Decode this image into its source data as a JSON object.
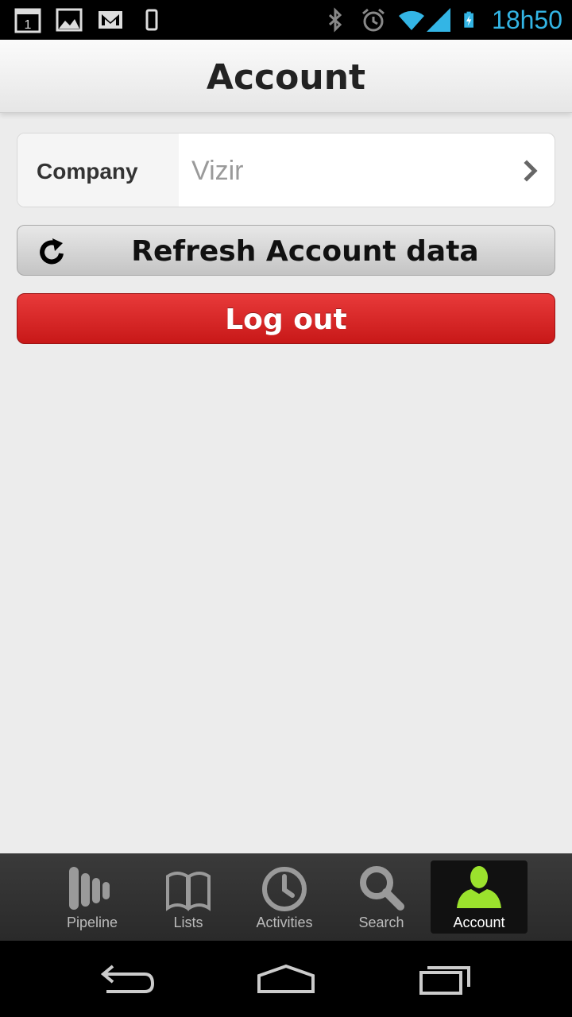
{
  "status_bar": {
    "time": "18h50",
    "left_icons": [
      "calendar-icon",
      "gallery-icon",
      "gmail-icon",
      "phone-vibrate-icon"
    ],
    "right_icons": [
      "bluetooth-icon",
      "alarm-icon",
      "wifi-icon",
      "signal-icon",
      "battery-charging-icon"
    ]
  },
  "header": {
    "title": "Account"
  },
  "company": {
    "label": "Company",
    "value": "Vizir"
  },
  "buttons": {
    "refresh_label": "Refresh Account data",
    "logout_label": "Log out"
  },
  "tabs": [
    {
      "label": "Pipeline",
      "icon": "pipeline-icon",
      "active": false
    },
    {
      "label": "Lists",
      "icon": "book-icon",
      "active": false
    },
    {
      "label": "Activities",
      "icon": "clock-icon",
      "active": false
    },
    {
      "label": "Search",
      "icon": "search-icon",
      "active": false
    },
    {
      "label": "Account",
      "icon": "user-icon",
      "active": true
    }
  ],
  "colors": {
    "status_time": "#33b5e5",
    "logout": "#d92626",
    "active_account_icon": "#9be22d"
  }
}
